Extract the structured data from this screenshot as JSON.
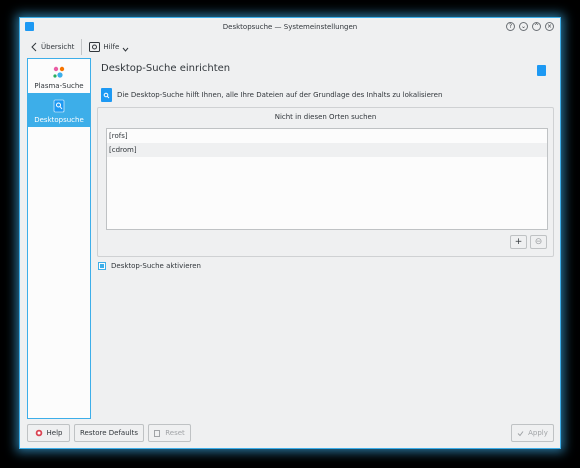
{
  "window": {
    "title": "Desktopsuche — Systemeinstellungen",
    "controls": [
      "?",
      "⌄",
      "^",
      "×"
    ]
  },
  "toolbar": {
    "overview_label": "Übersicht",
    "help_label": "Hilfe"
  },
  "sidebar": {
    "items": [
      {
        "label": "Plasma-Suche",
        "icon": "plasma-search-icon",
        "active": false
      },
      {
        "label": "Desktopsuche",
        "icon": "desktop-search-icon",
        "active": true
      }
    ]
  },
  "main": {
    "title": "Desktop-Suche einrichten",
    "info_text": "Die Desktop-Suche hilft Ihnen, alle Ihre Dateien auf der Grundlage des Inhalts zu lokalisieren",
    "exclude_group_title": "Nicht in diesen Orten suchen",
    "excluded_paths": [
      "[rofs]",
      "[cdrom]"
    ],
    "add_symbol": "+",
    "remove_symbol": "⊖",
    "enable_checkbox_label": "Desktop-Suche aktivieren",
    "enable_checked": true
  },
  "buttons": {
    "help": "Help",
    "restore_defaults": "Restore Defaults",
    "reset": "Reset",
    "apply": "Apply"
  },
  "colors": {
    "accent": "#3daee9",
    "window_bg": "#eff0f1",
    "view_bg": "#fcfcfc",
    "text": "#31363b"
  }
}
